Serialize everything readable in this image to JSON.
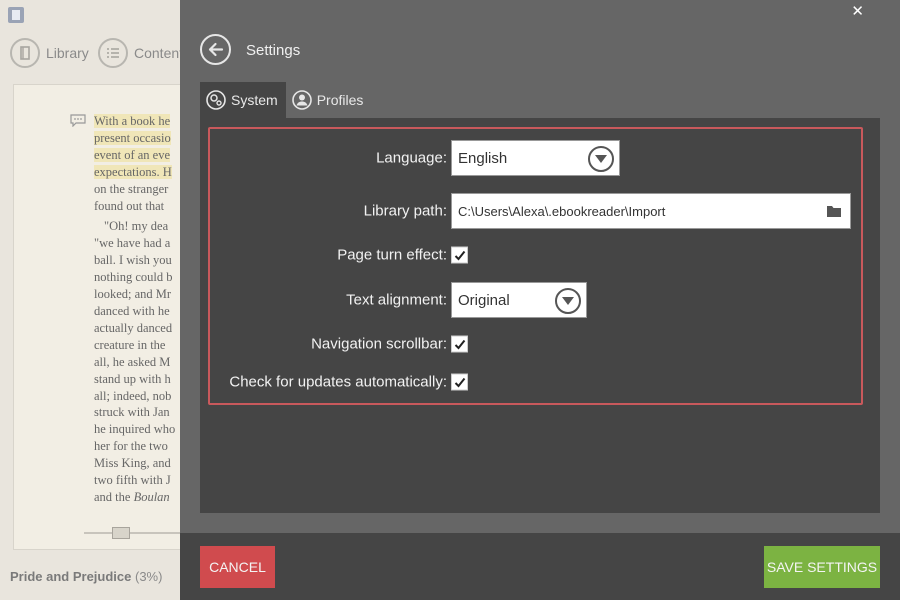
{
  "reader": {
    "nav": {
      "library": "Library",
      "contents": "Contents"
    },
    "book_lines": [
      "With a book he",
      "present occasio",
      "event of an eve",
      "expectations. H",
      "on the stranger",
      "found out that",
      "\"Oh! my dea",
      "\"we have had a",
      "ball. I wish you",
      "nothing could b",
      "looked; and Mr",
      "danced with he",
      "actually danced",
      "creature in the",
      "all, he asked M",
      "stand up with h",
      "all; indeed, nob",
      "struck with Jan",
      "he inquired who",
      "her for the two",
      "Miss King, and",
      "two fifth with J",
      "and the Boulan"
    ],
    "book_title": "Pride and Prejudice",
    "progress": "(3%)"
  },
  "settings": {
    "title": "Settings",
    "tabs": [
      {
        "label": "System",
        "active": true
      },
      {
        "label": "Profiles",
        "active": false
      }
    ],
    "language": {
      "label": "Language:",
      "value": "English"
    },
    "library_path": {
      "label": "Library path:",
      "value": "C:\\Users\\Alexa\\.ebookreader\\Import"
    },
    "page_turn": {
      "label": "Page turn effect:",
      "checked": true
    },
    "text_alignment": {
      "label": "Text alignment:",
      "value": "Original"
    },
    "nav_scrollbar": {
      "label": "Navigation scrollbar:",
      "checked": true
    },
    "auto_updates": {
      "label": "Check for updates automatically:",
      "checked": true
    },
    "cancel_label": "CANCEL",
    "save_label": "SAVE SETTINGS",
    "colors": {
      "cancel": "#d04b4e",
      "save": "#7cb342",
      "highlight_border": "#c9595c"
    }
  }
}
